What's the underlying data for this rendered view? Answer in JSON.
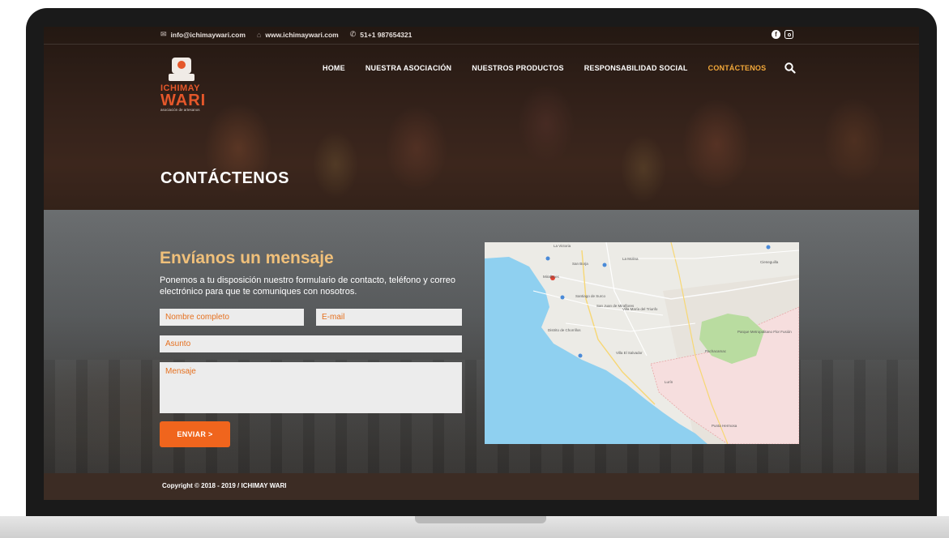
{
  "topbar": {
    "email": "info@ichimaywari.com",
    "website": "www.ichimaywari.com",
    "phone": "51+1 987654321",
    "icons": [
      "email-icon",
      "home-icon",
      "phone-icon",
      "facebook-icon",
      "instagram-icon"
    ]
  },
  "logo": {
    "line1": "ICHIMAY",
    "line2": "WARI",
    "subtitle": "asociación de artesanos"
  },
  "nav": {
    "items": [
      {
        "label": "HOME"
      },
      {
        "label": "NUESTRA ASOCIACIÓN"
      },
      {
        "label": "NUESTROS PRODUCTOS"
      },
      {
        "label": "RESPONSABILIDAD SOCIAL"
      },
      {
        "label": "CONTÁCTENOS"
      }
    ],
    "active": "CONTÁCTENOS"
  },
  "hero": {
    "title": "CONTÁCTENOS"
  },
  "contact_form": {
    "heading": "Envíanos un mensaje",
    "description": "Ponemos a tu disposición nuestro formulario de contacto, teléfono y correo electrónico para que te comuniques con nosotros.",
    "name_placeholder": "Nombre completo",
    "email_placeholder": "E-mail",
    "subject_placeholder": "Asunto",
    "message_placeholder": "Mensaje",
    "submit_label": "ENVIAR >"
  },
  "map": {
    "labels": [
      "La Victoria",
      "La Molina",
      "San Borja",
      "Miraflores",
      "Santiago de Surco",
      "San Juan de Miraflores",
      "Villa María del Triunfo",
      "Distrito de Chorrillos",
      "Villa El Salvador",
      "Pachacamac",
      "Lurín",
      "Punta Hermosa",
      "Cieneguilla",
      "Parque Metropolitano Flor Fusión"
    ]
  },
  "footer": {
    "copyright": "Copyright © 2018 - 2019  / ICHIMAY WARI"
  },
  "colors": {
    "accent": "#f0651d",
    "nav_active": "#f4a93a",
    "heading": "#f0c07a",
    "footer_bg": "#3c2c24"
  }
}
